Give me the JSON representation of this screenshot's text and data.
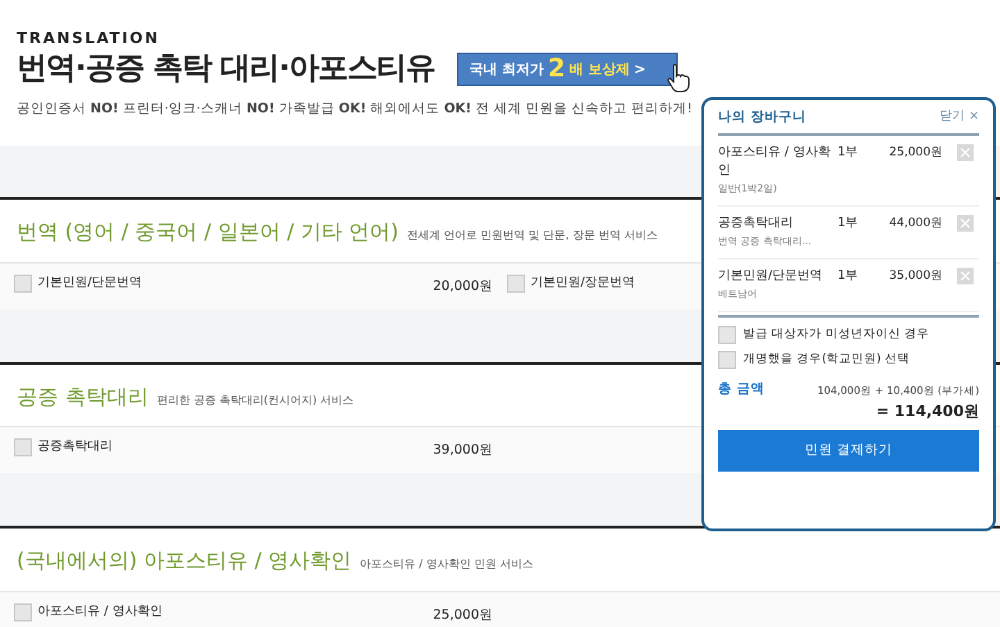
{
  "header": {
    "eyebrow": "TRANSLATION",
    "title": "번역·공증 촉탁 대리·아포스티유",
    "promo": {
      "before": "국내 최저가",
      "highlight": "2",
      "after": "배 보상제",
      "arrow": ">"
    },
    "tagline": "공인인증서 **NO!** 프린터·잉크·스캐너 **NO!** 가족발급 **OK!** 해외에서도 **OK!** 전 세계 민원을 신속하고 편리하게!"
  },
  "sections": [
    {
      "title": "번역 (영어 / 중국어 / 일본어 / 기타 언어)",
      "subtitle": "전세계 언어로 민원번역 및 단문, 장문 번역 서비스",
      "items": [
        {
          "label": "기본민원/단문번역",
          "price": "20,000원",
          "checked": false
        },
        {
          "label": "기본민원/장문번역",
          "checked": false
        }
      ]
    },
    {
      "title": "공증 촉탁대리",
      "subtitle": "편리한 공증 촉탁대리(컨시어지) 서비스",
      "items": [
        {
          "label": "공증촉탁대리",
          "price": "39,000원",
          "checked": false
        }
      ]
    },
    {
      "title": "(국내에서의) 아포스티유 / 영사확인",
      "subtitle": "아포스티유 / 영사확인 민원 서비스",
      "items": [
        {
          "label": "아포스티유 / 영사확인",
          "price": "25,000원",
          "checked": false
        }
      ]
    }
  ],
  "cart": {
    "title": "나의 장바구니",
    "close": "닫기 ×",
    "items": [
      {
        "name": "아포스티유 / 영사확인",
        "detail": "일반(1박2일)",
        "qty": "1부",
        "price": "25,000원"
      },
      {
        "name": "공증촉탁대리",
        "detail": "번역 공증 촉탁대리...",
        "qty": "1부",
        "price": "44,000원"
      },
      {
        "name": "기본민원/단문번역",
        "detail": "베트남어",
        "qty": "1부",
        "price": "35,000원"
      }
    ],
    "options": [
      {
        "label": "발급 대상자가 미성년자이신 경우",
        "checked": false
      },
      {
        "label": "개명했을 경우(학교민원) 선택",
        "checked": false
      }
    ],
    "total_label": "총 금액",
    "total_breakdown": "104,000원 + 10,400원 (부가세)",
    "total": "= 114,400원",
    "pay_button": "민원 결제하기"
  }
}
